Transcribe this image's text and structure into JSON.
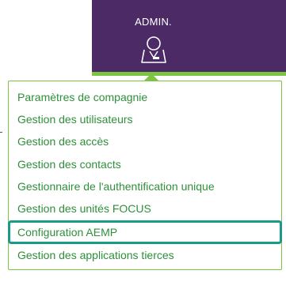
{
  "header": {
    "admin_label": "ADMIN.",
    "admin_icon": "user-admin-icon",
    "tab_color": "#4b2a66",
    "accent_color": "#7cc442"
  },
  "menu": {
    "items": [
      {
        "label": "Paramètres de compagnie"
      },
      {
        "label": "Gestion des utilisateurs"
      },
      {
        "label": "Gestion des accès"
      },
      {
        "label": "Gestion des contacts"
      },
      {
        "label": "Gestionnaire de l'authentification unique"
      },
      {
        "label": "Gestion des unités FOCUS"
      },
      {
        "label": "Configuration AEMP"
      },
      {
        "label": "Gestion des applications tierces"
      }
    ],
    "highlighted_index": 6,
    "text_color": "#2f8f3a",
    "highlight_color": "#1a9a8a"
  }
}
